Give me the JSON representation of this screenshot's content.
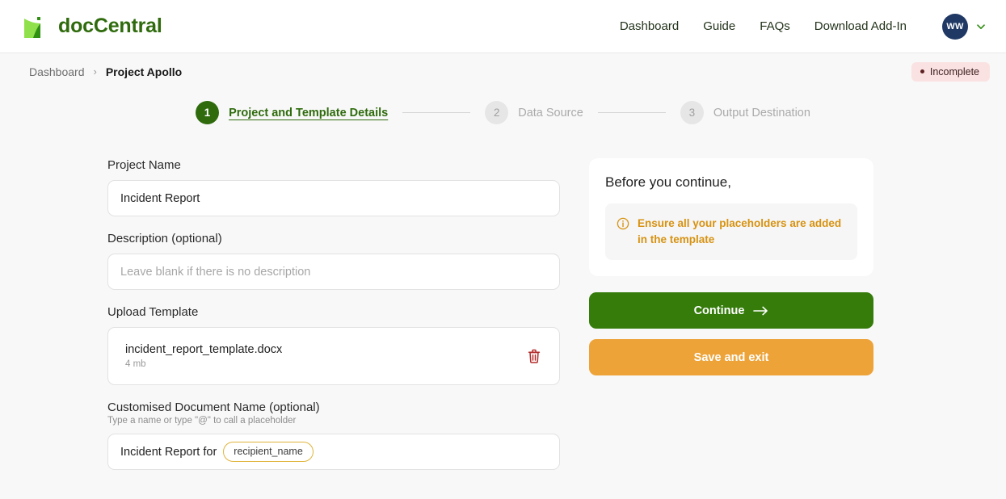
{
  "header": {
    "brand_name": "docCentral",
    "logo_icon": "doc-central-logo-icon",
    "nav": [
      {
        "label": "Dashboard",
        "name": "nav-dashboard"
      },
      {
        "label": "Guide",
        "name": "nav-guide"
      },
      {
        "label": "FAQs",
        "name": "nav-faqs"
      },
      {
        "label": "Download Add-In",
        "name": "nav-download-add-in"
      }
    ],
    "avatar_initials": "WW",
    "avatar_menu_icon": "chevron-down-icon"
  },
  "breadcrumb": {
    "root_label": "Dashboard",
    "separator": "›",
    "current_label": "Project Apollo"
  },
  "status": {
    "label": "Incomplete",
    "bg_color": "#fbe2e2",
    "text_color": "#3d2020"
  },
  "stepper": {
    "steps": [
      {
        "number": "1",
        "label": "Project and Template Details",
        "state": "active"
      },
      {
        "number": "2",
        "label": "Data Source",
        "state": "idle"
      },
      {
        "number": "3",
        "label": "Output Destination",
        "state": "idle"
      }
    ]
  },
  "form": {
    "project_name": {
      "label": "Project Name",
      "value": "Incident Report",
      "placeholder": ""
    },
    "description": {
      "label": "Description (optional)",
      "value": "",
      "placeholder": "Leave blank if there is no description"
    },
    "upload_template": {
      "label": "Upload Template",
      "file_name": "incident_report_template.docx",
      "file_size": "4 mb",
      "delete_icon": "trash-icon"
    },
    "custom_name": {
      "label": "Customised Document Name (optional)",
      "hint": "Type a name or type \"@\" to call a placeholder",
      "text": "Incident Report for",
      "token": "recipient_name",
      "token_border_color": "#e0b43a"
    }
  },
  "sidebar": {
    "title": "Before you continue,",
    "notice_icon": "info-circle-icon",
    "notice_text": "Ensure all your placeholders are added in the template",
    "notice_color": "#d79211",
    "continue_label": "Continue",
    "continue_icon": "arrow-right-icon",
    "continue_color": "#357c0b",
    "save_exit_label": "Save and exit",
    "save_exit_color": "#eda338"
  }
}
